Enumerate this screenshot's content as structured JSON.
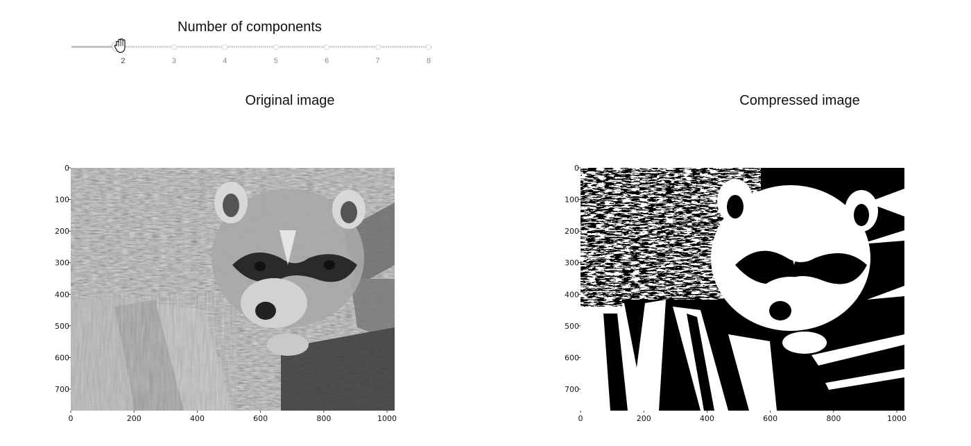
{
  "slider": {
    "title": "Number of components",
    "min": 1,
    "max": 8,
    "value": 2,
    "marks": [
      "2",
      "3",
      "4",
      "5",
      "6",
      "7",
      "8"
    ]
  },
  "panels": {
    "original": {
      "title": "Original image",
      "y_ticks": [
        "0",
        "100",
        "200",
        "300",
        "400",
        "500",
        "600",
        "700"
      ],
      "x_ticks": [
        "0",
        "200",
        "400",
        "600",
        "800",
        "1000"
      ]
    },
    "compressed": {
      "title": "Compressed image",
      "y_ticks": [
        "0",
        "100",
        "200",
        "300",
        "400",
        "500",
        "600",
        "700"
      ],
      "x_ticks": [
        "0",
        "200",
        "400",
        "600",
        "800",
        "1000"
      ]
    }
  },
  "colors": {
    "rail": "#d6d6d6",
    "handle_border": "#bdbdbd",
    "mark_text": "#8a8a8a"
  },
  "icons": {
    "cursor": "grab-hand-icon"
  }
}
